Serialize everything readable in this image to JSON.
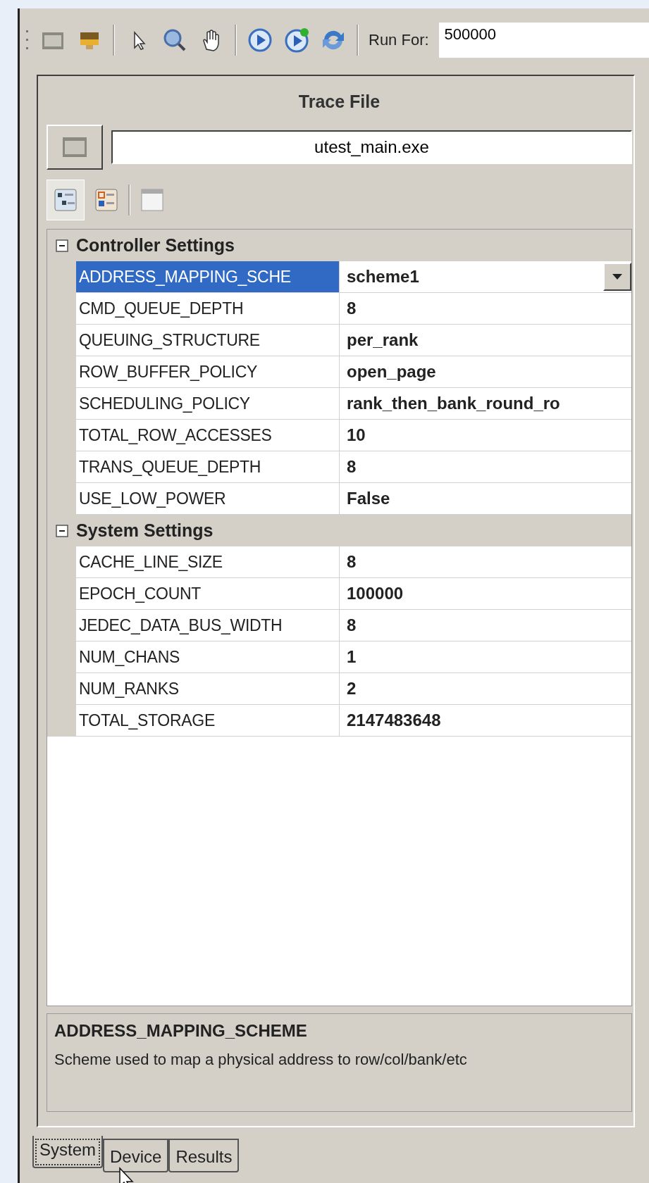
{
  "toolbar": {
    "run_for": {
      "label": "Run For:",
      "value": "500000"
    }
  },
  "panel": {
    "title": "Trace File",
    "trace_file": "utest_main.exe",
    "view_buttons": [
      {
        "kind": "categorized",
        "selected": true
      },
      {
        "kind": "alphabetical",
        "selected": false
      },
      {
        "kind": "pages",
        "selected": false
      }
    ],
    "property_grid": {
      "categories": [
        {
          "name": "Controller Settings",
          "expanded": true,
          "properties": [
            {
              "name": "ADDRESS_MAPPING_SCHE",
              "value": "scheme1",
              "kind": "dropdown",
              "selected": true
            },
            {
              "name": "CMD_QUEUE_DEPTH",
              "value": "8",
              "kind": "text",
              "selected": false
            },
            {
              "name": "QUEUING_STRUCTURE",
              "value": "per_rank",
              "kind": "text",
              "selected": false
            },
            {
              "name": "ROW_BUFFER_POLICY",
              "value": "open_page",
              "kind": "text",
              "selected": false
            },
            {
              "name": "SCHEDULING_POLICY",
              "value": "rank_then_bank_round_ro",
              "kind": "text",
              "selected": false
            },
            {
              "name": "TOTAL_ROW_ACCESSES",
              "value": "10",
              "kind": "text",
              "selected": false
            },
            {
              "name": "TRANS_QUEUE_DEPTH",
              "value": "8",
              "kind": "text",
              "selected": false
            },
            {
              "name": "USE_LOW_POWER",
              "value": "False",
              "kind": "text",
              "selected": false
            }
          ]
        },
        {
          "name": "System Settings",
          "expanded": true,
          "properties": [
            {
              "name": "CACHE_LINE_SIZE",
              "value": "8",
              "kind": "text",
              "selected": false
            },
            {
              "name": "EPOCH_COUNT",
              "value": "100000",
              "kind": "text",
              "selected": false
            },
            {
              "name": "JEDEC_DATA_BUS_WIDTH",
              "value": "8",
              "kind": "text",
              "selected": false
            },
            {
              "name": "NUM_CHANS",
              "value": "1",
              "kind": "text",
              "selected": false
            },
            {
              "name": "NUM_RANKS",
              "value": "2",
              "kind": "text",
              "selected": false
            },
            {
              "name": "TOTAL_STORAGE",
              "value": "2147483648",
              "kind": "text",
              "selected": false
            }
          ]
        }
      ]
    },
    "description": {
      "title": "ADDRESS_MAPPING_SCHEME",
      "text": "Scheme used to map a physical address to row/col/bank/etc"
    }
  },
  "tabs": [
    {
      "label": "System",
      "selected": true
    },
    {
      "label": "Device",
      "selected": false
    },
    {
      "label": "Results",
      "selected": false
    }
  ]
}
